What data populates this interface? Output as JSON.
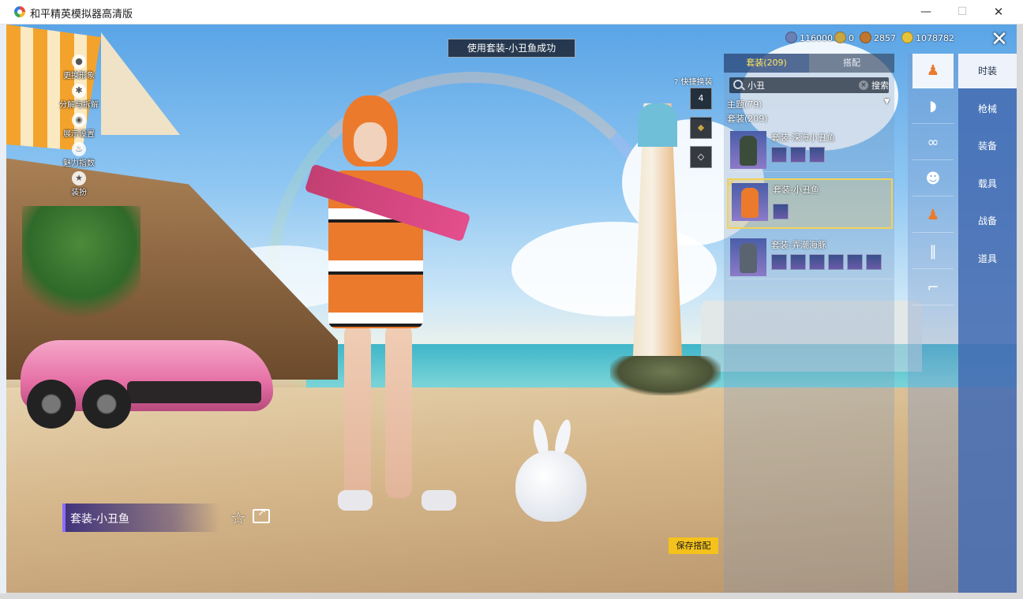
{
  "window": {
    "title": "和平精英模拟器高清版",
    "minimize": "—",
    "maximize": "☐",
    "close": "✕"
  },
  "left_menu": [
    {
      "label": "更换形象",
      "icon": "person-icon"
    },
    {
      "label": "分解与拆解",
      "icon": "gear-icon"
    },
    {
      "label": "展示设置",
      "icon": "eye-icon"
    },
    {
      "label": "魅力指数",
      "icon": "flame-icon"
    },
    {
      "label": "装扮",
      "icon": "badge-icon"
    }
  ],
  "toast": "使用套装-小丑鱼成功",
  "currencies": [
    {
      "value": "116000",
      "color": "#6a7fb5"
    },
    {
      "value": "0",
      "color": "#c8a646"
    },
    {
      "value": "2857",
      "color": "#c0762e"
    },
    {
      "value": "1078782",
      "color": "#e8c23a"
    }
  ],
  "close_label": "✕",
  "quick": {
    "label": "快捷换装",
    "slot_number": "4"
  },
  "panel": {
    "tab_active": "套装(209)",
    "tab_inactive": "搭配",
    "search_value": "小丑",
    "search_button": "搜索",
    "filter_label": "主题(79)",
    "count_label": "套装(209)",
    "items": [
      {
        "name": "套装-深海小丑鱼",
        "subs": 3
      },
      {
        "name": "套装-小丑鱼",
        "subs": 1
      },
      {
        "name": "套装-弄潮海豚",
        "subs": 6
      }
    ]
  },
  "categories": [
    "outfit-icon",
    "cap-icon",
    "goggles-icon",
    "mask-icon",
    "suit-icon",
    "pants-icon",
    "shoes-icon"
  ],
  "nav": [
    "时装",
    "枪械",
    "装备",
    "载具",
    "战备",
    "道具"
  ],
  "outfit_name": "套装-小丑鱼",
  "save_button": "保存搭配"
}
